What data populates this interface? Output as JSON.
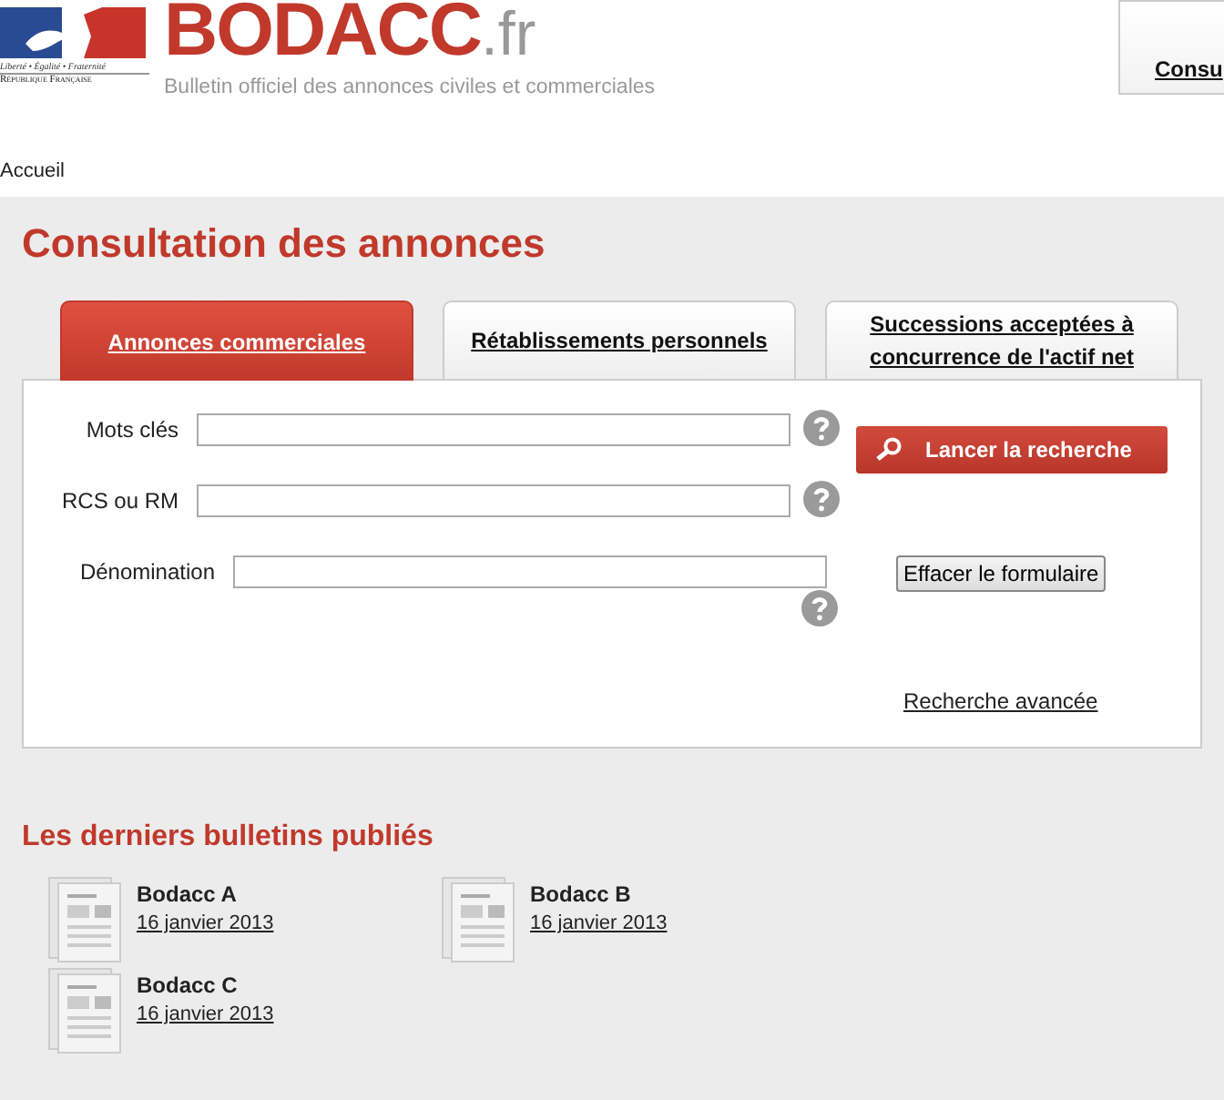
{
  "header": {
    "motto": "Liberté • Égalité • Fraternité",
    "republic": "République Française",
    "site_name": "BODACC",
    "site_suffix": ".fr",
    "tagline": "Bulletin officiel des annonces civiles et commerciales",
    "top_link": "Consu"
  },
  "breadcrumb": "Accueil",
  "title": "Consultation des annonces",
  "tabs": [
    {
      "label": "Annonces commerciales",
      "selected": true
    },
    {
      "label": "Rétablissements personnels",
      "selected": false
    },
    {
      "label": "Successions acceptées à concurrence de l'actif net",
      "selected": false
    }
  ],
  "fields": [
    {
      "label": "Mots clés"
    },
    {
      "label": "RCS ou RM"
    },
    {
      "label": "Dénomination"
    }
  ],
  "search_button": "Lancer la recherche",
  "clear_button": "Effacer le formulaire",
  "advanced_link": "Recherche avancée",
  "bulletins_title": "Les derniers bulletins publiés",
  "bulletins": [
    {
      "name": "Bodacc A",
      "date": "16 janvier 2013"
    },
    {
      "name": "Bodacc B",
      "date": "16 janvier 2013"
    },
    {
      "name": "Bodacc C",
      "date": "16 janvier 2013"
    }
  ]
}
